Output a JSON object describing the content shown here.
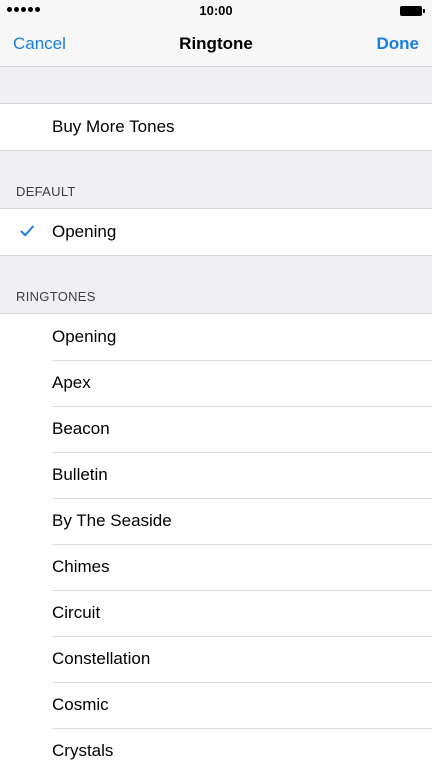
{
  "status_bar": {
    "time": "10:00",
    "signal_icon": "signal-dots-icon",
    "battery_icon": "battery-icon"
  },
  "nav": {
    "cancel_label": "Cancel",
    "title": "Ringtone",
    "done_label": "Done"
  },
  "store": {
    "buy_label": "Buy More Tones"
  },
  "default_section": {
    "header": "DEFAULT",
    "selected": "Opening",
    "check_icon": "checkmark-icon"
  },
  "ringtones_section": {
    "header": "RINGTONES",
    "items": [
      "Opening",
      "Apex",
      "Beacon",
      "Bulletin",
      "By The Seaside",
      "Chimes",
      "Circuit",
      "Constellation",
      "Cosmic",
      "Crystals"
    ]
  },
  "colors": {
    "accent": "#1a7ee0",
    "background": "#efeff4",
    "bar_background": "#f7f7f7"
  }
}
